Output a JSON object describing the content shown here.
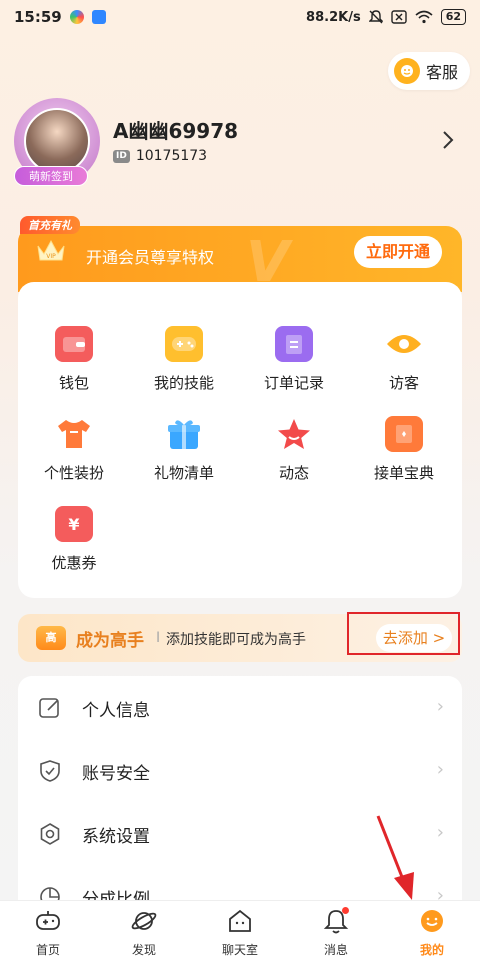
{
  "status_bar": {
    "time": "15:59",
    "net_speed": "88.2K/s",
    "battery": "62"
  },
  "header": {
    "kefu_label": "客服"
  },
  "profile": {
    "avatar_badge": "萌新签到",
    "username": "A幽幽69978",
    "id_tag": "ID",
    "user_id": "10175173"
  },
  "vip": {
    "tag": "首充有礼",
    "text": "开通会员尊享特权",
    "button": "立即开通",
    "crown_text": "VIP"
  },
  "grid": {
    "items": [
      {
        "label": "钱包",
        "icon": "wallet-icon",
        "color": "#f45c5c"
      },
      {
        "label": "我的技能",
        "icon": "gamepad-icon",
        "color": "#ffbf2e"
      },
      {
        "label": "订单记录",
        "icon": "order-list-icon",
        "color": "#9b6cf0"
      },
      {
        "label": "访客",
        "icon": "eye-icon",
        "color": "#ffb020"
      },
      {
        "label": "个性装扮",
        "icon": "tshirt-icon",
        "color": "#ff7a3a"
      },
      {
        "label": "礼物清单",
        "icon": "gift-icon",
        "color": "#3aa7ff"
      },
      {
        "label": "动态",
        "icon": "star-icon",
        "color": "#f24a4a"
      },
      {
        "label": "接单宝典",
        "icon": "book-icon",
        "color": "#ff7a3a"
      },
      {
        "label": "优惠券",
        "icon": "coupon-icon",
        "color": "#f45c5c"
      }
    ]
  },
  "gaoshou": {
    "badge": "高",
    "title": "成为高手",
    "separator": "I",
    "subtitle": "添加技能即可成为高手",
    "button": "去添加 >"
  },
  "menu": {
    "items": [
      {
        "label": "个人信息",
        "icon": "edit-icon"
      },
      {
        "label": "账号安全",
        "icon": "shield-icon"
      },
      {
        "label": "系统设置",
        "icon": "settings-icon"
      },
      {
        "label": "分成比例",
        "icon": "pie-chart-icon"
      }
    ]
  },
  "bottom_nav": {
    "items": [
      {
        "label": "首页",
        "icon": "home-gamepad-icon"
      },
      {
        "label": "发现",
        "icon": "planet-icon"
      },
      {
        "label": "聊天室",
        "icon": "chatroom-icon"
      },
      {
        "label": "消息",
        "icon": "bell-icon"
      },
      {
        "label": "我的",
        "icon": "me-icon"
      }
    ],
    "active": "我的"
  },
  "colors": {
    "accent": "#ff8a1a",
    "vip_orange": "#ffa21f",
    "highlight_red": "#e0262a"
  }
}
